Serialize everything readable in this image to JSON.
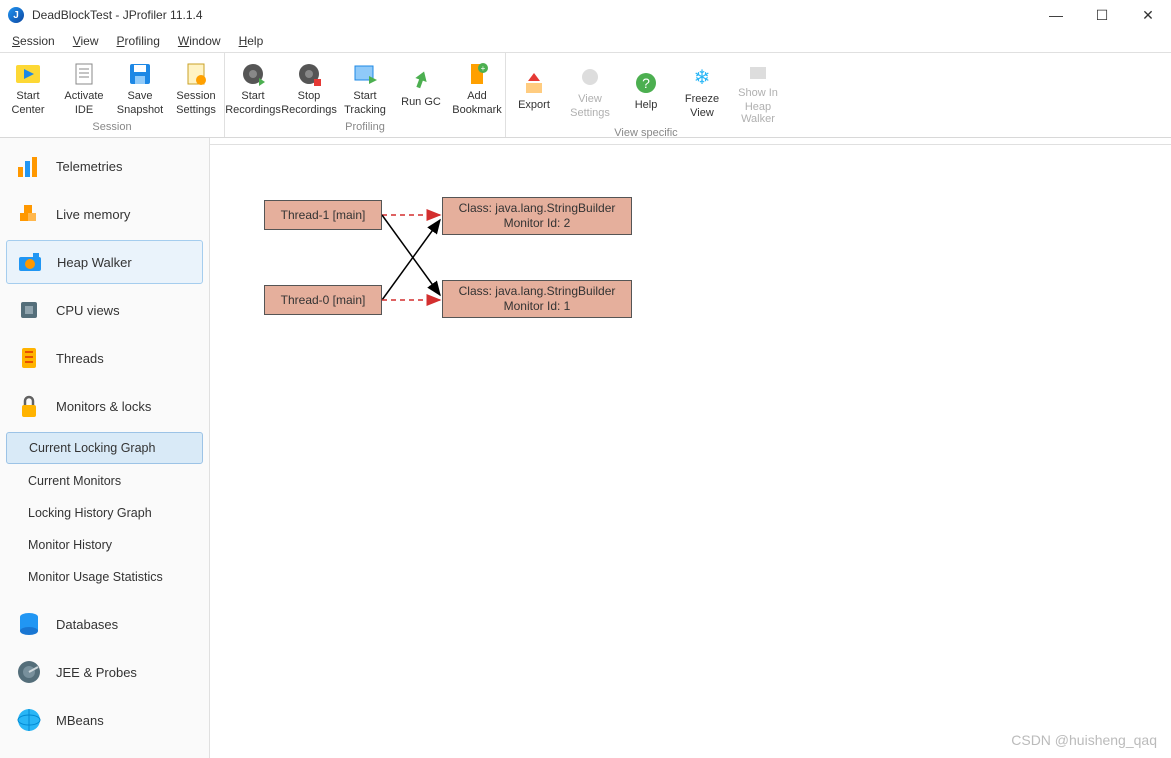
{
  "title": "DeadBlockTest - JProfiler 11.1.4",
  "menu": [
    "Session",
    "View",
    "Profiling",
    "Window",
    "Help"
  ],
  "toolbar_groups": [
    {
      "label": "Session",
      "buttons": [
        {
          "id": "start-center",
          "line1": "Start",
          "line2": "Center"
        },
        {
          "id": "activate-ide",
          "line1": "Activate",
          "line2": "IDE"
        },
        {
          "id": "save-snapshot",
          "line1": "Save",
          "line2": "Snapshot"
        },
        {
          "id": "session-settings",
          "line1": "Session",
          "line2": "Settings"
        }
      ]
    },
    {
      "label": "Profiling",
      "buttons": [
        {
          "id": "start-recordings",
          "line1": "Start",
          "line2": "Recordings"
        },
        {
          "id": "stop-recordings",
          "line1": "Stop",
          "line2": "Recordings"
        },
        {
          "id": "start-tracking",
          "line1": "Start",
          "line2": "Tracking"
        },
        {
          "id": "run-gc",
          "line1": "Run GC",
          "line2": ""
        },
        {
          "id": "add-bookmark",
          "line1": "Add",
          "line2": "Bookmark"
        }
      ]
    },
    {
      "label": "View specific",
      "buttons": [
        {
          "id": "export",
          "line1": "Export",
          "line2": ""
        },
        {
          "id": "view-settings",
          "line1": "View",
          "line2": "Settings",
          "disabled": true
        },
        {
          "id": "help",
          "line1": "Help",
          "line2": ""
        },
        {
          "id": "freeze-view",
          "line1": "Freeze",
          "line2": "View"
        },
        {
          "id": "show-in-heap",
          "line1": "Show In",
          "line2": "Heap Walker",
          "disabled": true
        }
      ]
    }
  ],
  "sidebar": {
    "items": [
      {
        "id": "telemetries",
        "label": "Telemetries"
      },
      {
        "id": "live-memory",
        "label": "Live memory"
      },
      {
        "id": "heap-walker",
        "label": "Heap Walker",
        "selected": true
      },
      {
        "id": "cpu-views",
        "label": "CPU views"
      },
      {
        "id": "threads",
        "label": "Threads"
      },
      {
        "id": "monitors-locks",
        "label": "Monitors & locks"
      }
    ],
    "sub_items": [
      {
        "id": "current-locking-graph",
        "label": "Current Locking Graph",
        "selected": true
      },
      {
        "id": "current-monitors",
        "label": "Current Monitors"
      },
      {
        "id": "locking-history-graph",
        "label": "Locking History Graph"
      },
      {
        "id": "monitor-history",
        "label": "Monitor History"
      },
      {
        "id": "monitor-usage-stats",
        "label": "Monitor Usage Statistics"
      }
    ],
    "items2": [
      {
        "id": "databases",
        "label": "Databases"
      },
      {
        "id": "jee-probes",
        "label": "JEE & Probes"
      },
      {
        "id": "mbeans",
        "label": "MBeans"
      }
    ]
  },
  "graph": {
    "threads": [
      {
        "id": "thread-1",
        "label": "Thread-1 [main]"
      },
      {
        "id": "thread-0",
        "label": "Thread-0 [main]"
      }
    ],
    "monitors": [
      {
        "id": "monitor-2",
        "class_line": "Class: java.lang.StringBuilder",
        "id_line": "Monitor Id: 2"
      },
      {
        "id": "monitor-1",
        "class_line": "Class: java.lang.StringBuilder",
        "id_line": "Monitor Id: 1"
      }
    ]
  },
  "watermark": "CSDN @huisheng_qaq"
}
